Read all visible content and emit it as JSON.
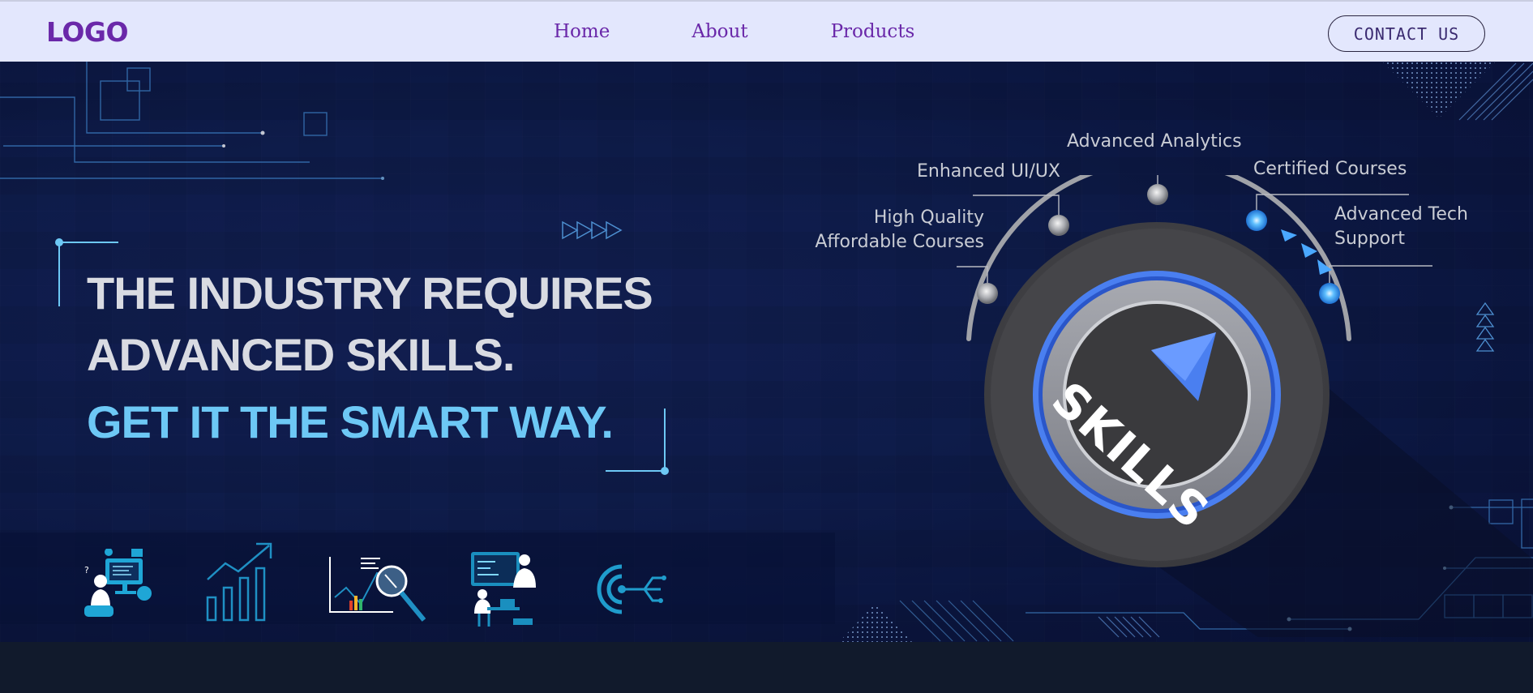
{
  "nav": {
    "logo": "LOGO",
    "links": [
      "Home",
      "About",
      "Products"
    ],
    "contact": "CONTACT US"
  },
  "hero": {
    "headline_line1": "THE INDUSTRY REQUIRES",
    "headline_line2": "ADVANCED SKILLS.",
    "tagline": "GET IT THE SMART WAY.",
    "dial_text": "SKILLS",
    "dial_labels": {
      "quality_line1": "High Quality",
      "quality_line2": "Affordable Courses",
      "uiux": "Enhanced UI/UX",
      "analytics": "Advanced Analytics",
      "certified": "Certified Courses",
      "support_line1": "Advanced Tech",
      "support_line2": "Support"
    },
    "feature_icons": [
      "people-computer-icon",
      "growth-chart-icon",
      "analytics-search-icon",
      "team-work-icon",
      "target-icon"
    ]
  },
  "colors": {
    "nav_bg": "#e3e7fd",
    "brand_purple": "#6a28a9",
    "hero_bg": "#102052",
    "accent_cyan": "#6dc8f5",
    "dial_blue": "#4a7ff0"
  }
}
